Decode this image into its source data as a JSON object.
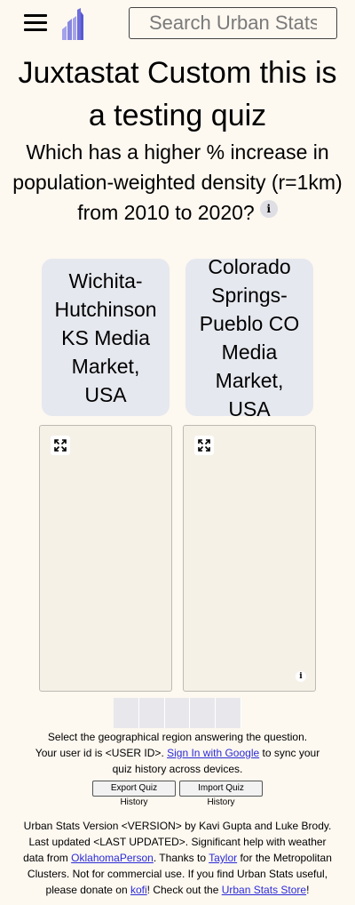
{
  "header": {
    "search_placeholder": "Search Urban Stats"
  },
  "quiz": {
    "title": "Juxtastat Custom this is a testing quiz",
    "question": "Which has a higher % increase in population-weighted density (r=1km) from 2010 to 2020?",
    "info_glyph": "i",
    "answers": [
      {
        "label": "Wichita-Hutchinson KS Media Market, USA"
      },
      {
        "label": "Colorado Springs-Pueblo CO Media Market, USA"
      }
    ],
    "attribution_glyph": "i"
  },
  "progress": {
    "total": 5,
    "completed": 0
  },
  "instructions": "Select the geographical region answering the question.",
  "user": {
    "id_prefix": "Your user id is ",
    "id": "<USER ID>",
    "id_suffix": ". ",
    "sign_in_link": "Sign In with Google",
    "sync_text": " to sync your quiz history across devices."
  },
  "buttons": {
    "export": "Export Quiz History",
    "import": "Import Quiz History"
  },
  "footer": {
    "t1": "Urban Stats Version ",
    "version": "<VERSION>",
    "t2": " by Kavi Gupta and Luke Brody. Last updated ",
    "last_updated": "<LAST UPDATED>",
    "t3": ". Significant help with weather data from ",
    "link_oklahoma": "OklahomaPerson",
    "t4": ". Thanks to ",
    "link_taylor": "Taylor",
    "t5": " for the Metropolitan Clusters. Not for commercial use. If you find Urban Stats useful, please donate on ",
    "link_kofi": "kofi",
    "t6": "! Check out the ",
    "link_store": "Urban Stats Store",
    "t7": "!"
  },
  "colors": {
    "background": "#fdf8f0",
    "answer_bg": "#e6e8ef",
    "map_bg": "#f5f1e7",
    "link": "#2b2bd8",
    "logo_dark": "#5a5bd6",
    "logo_light": "#9f9ee8"
  }
}
